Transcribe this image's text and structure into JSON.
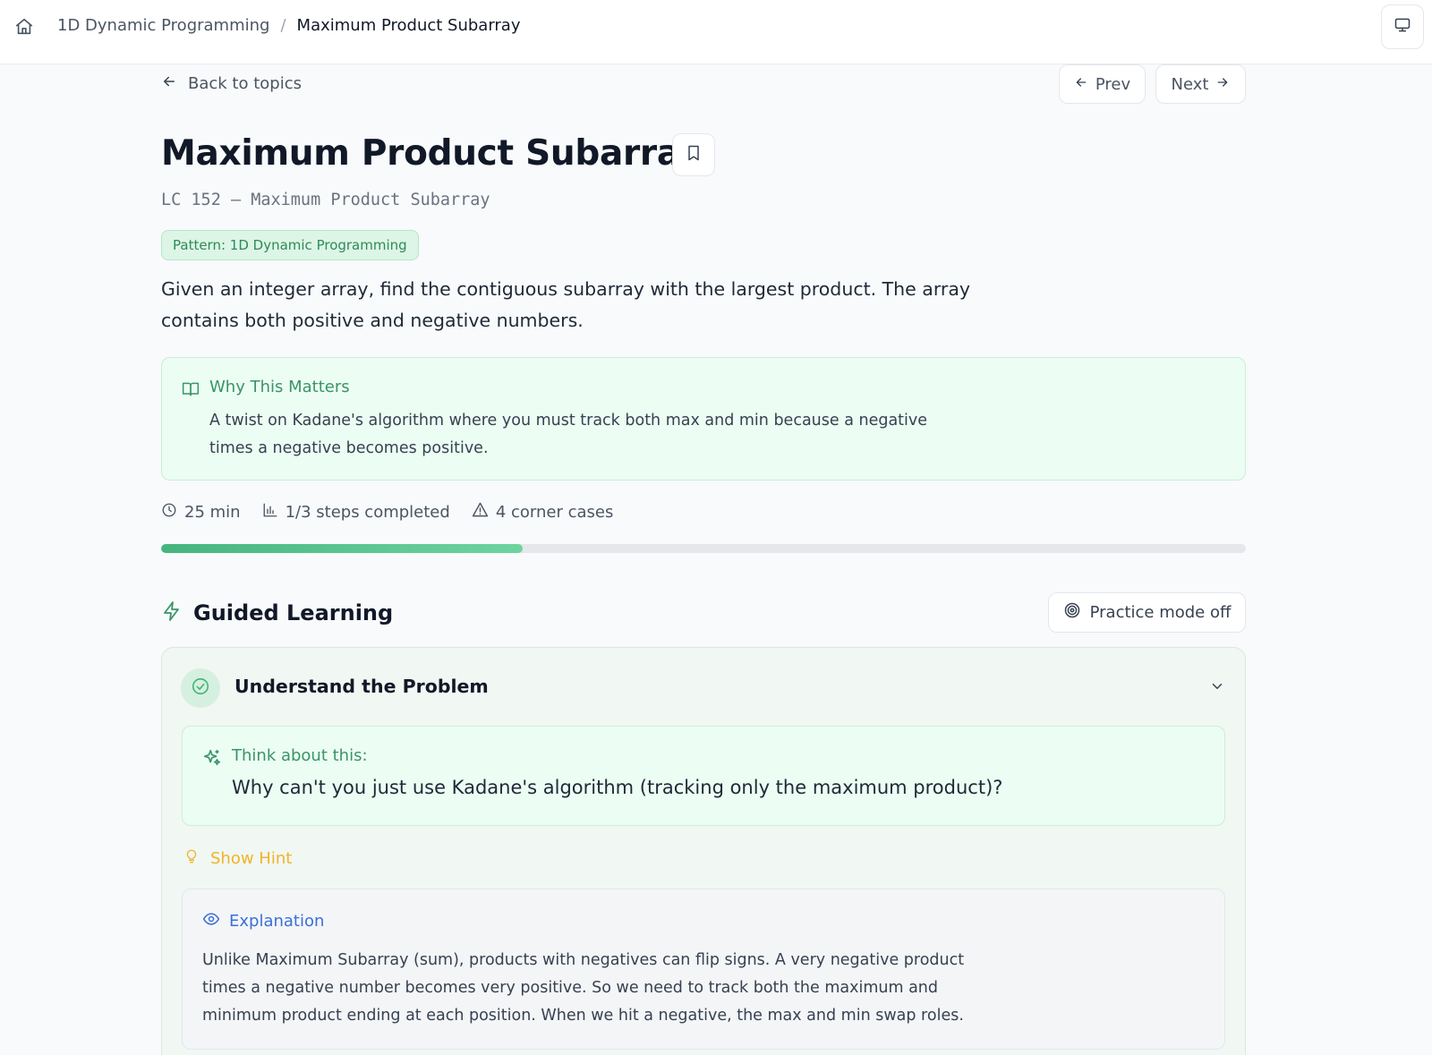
{
  "breadcrumb": {
    "topic": "1D Dynamic Programming",
    "separator": "/",
    "current": "Maximum Product Subarray"
  },
  "nav": {
    "back_label": "Back to topics",
    "prev_label": "Prev",
    "next_label": "Next"
  },
  "problem": {
    "title": "Maximum Product Subarray",
    "subtitle": "LC 152 — Maximum Product Subarray",
    "pattern_badge": "Pattern: 1D Dynamic Programming",
    "description": "Given an integer array, find the contiguous subarray with the largest product. The array contains both positive and negative numbers."
  },
  "why": {
    "title": "Why This Matters",
    "text": "A twist on Kadane's algorithm where you must track both max and min because a negative times a negative becomes positive."
  },
  "stats": {
    "time": "25 min",
    "steps": "1/3 steps completed",
    "corner_cases": "4 corner cases"
  },
  "progress": {
    "fraction": 0.333
  },
  "guided": {
    "title": "Guided Learning",
    "practice_label": "Practice mode off"
  },
  "step": {
    "title": "Understand the Problem",
    "think_label": "Think about this:",
    "question": "Why can't you just use Kadane's algorithm (tracking only the maximum product)?",
    "hint_label": "Show Hint",
    "explanation_label": "Explanation",
    "explanation_text": "Unlike Maximum Subarray (sum), products with negatives can flip signs. A very negative product times a negative number becomes very positive. So we need to track both the maximum and minimum product ending at each position. When we hit a negative, the max and min swap roles."
  },
  "icons": {
    "home": "home-icon",
    "device": "monitor-icon",
    "back": "arrow-left-icon",
    "prev": "arrow-left-icon",
    "next": "arrow-right-icon",
    "bookmark": "bookmark-icon",
    "why": "book-open-icon",
    "time": "clock-icon",
    "steps": "bar-chart-icon",
    "corner": "alert-triangle-icon",
    "guided": "lightning-icon",
    "practice": "target-icon",
    "step_status": "check-circle-icon",
    "collapse": "chevron-down-icon",
    "think": "sparkles-icon",
    "hint": "lightbulb-icon",
    "explanation": "eye-icon"
  },
  "colors": {
    "accent_green": "#3a9468",
    "progress": "#45b57d",
    "hint": "#f0b429",
    "explanation": "#3b6fd9"
  }
}
